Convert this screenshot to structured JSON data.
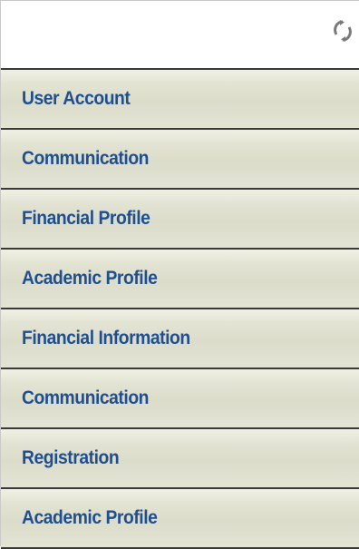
{
  "header": {
    "refresh_icon": "refresh-icon"
  },
  "menu": {
    "items": [
      {
        "label": "User Account"
      },
      {
        "label": "Communication"
      },
      {
        "label": "Financial Profile"
      },
      {
        "label": "Academic Profile"
      },
      {
        "label": "Financial Information"
      },
      {
        "label": "Communication"
      },
      {
        "label": "Registration"
      },
      {
        "label": "Academic Profile"
      }
    ]
  },
  "colors": {
    "label_text": "#1f4f8e",
    "item_background": "#e0e0d0",
    "divider": "#3a3a3a",
    "icon": "#7a7a7a"
  }
}
